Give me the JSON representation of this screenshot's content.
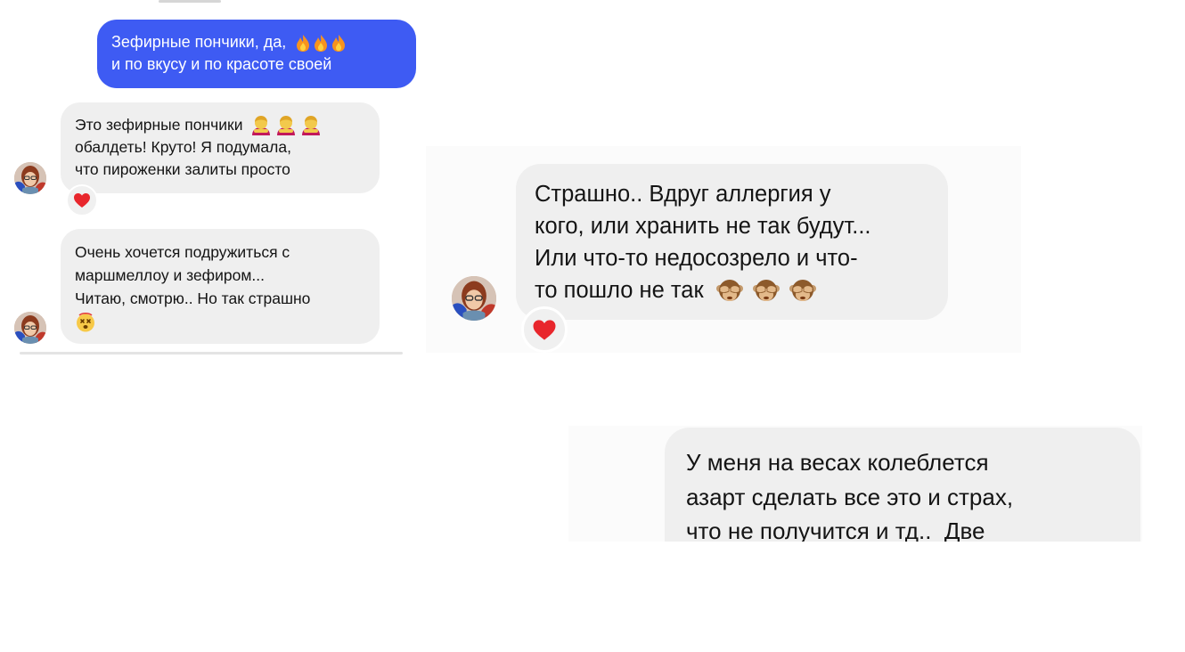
{
  "left_panel": {
    "sent_message": {
      "lines": [
        "Зефирные пончики, да,",
        "и по вкусу и по красоте своей"
      ],
      "emojis": [
        "fire-emoji",
        "fire-emoji",
        "fire-emoji"
      ]
    },
    "received_message_1": {
      "lines": [
        "Это зефирные пончики",
        "обалдеть! Круто! Я подумала,",
        "что пироженки залиты просто"
      ],
      "emojis": [
        "person-bowing-emoji",
        "person-bowing-emoji",
        "person-bowing-emoji"
      ],
      "reaction": "red-heart"
    },
    "received_message_2": {
      "lines": [
        "Очень хочется подружиться с",
        "маршмеллоу и зефиром...",
        "Читаю, смотрю.. Но так страшно"
      ],
      "emojis": [
        "dizzy-face-emoji"
      ]
    }
  },
  "middle_panel": {
    "received_message": {
      "lines": [
        "Страшно.. Вдруг аллергия у",
        "кого, или хранить не так будут...",
        "Или что-то недосозрело и что-",
        "то пошло не так"
      ],
      "emojis": [
        "see-no-evil-monkey-emoji",
        "see-no-evil-monkey-emoji",
        "see-no-evil-monkey-emoji"
      ],
      "reaction": "red-heart"
    }
  },
  "bottom_panel": {
    "received_message": {
      "lines": [
        "У меня на весах колеблется",
        "азарт сделать все это и страх,",
        "что не получится и тд..  Две"
      ]
    }
  },
  "colors": {
    "sent_bubble": "#3e5bf3",
    "received_bubble": "#efefef",
    "heart": "#e8262c"
  }
}
